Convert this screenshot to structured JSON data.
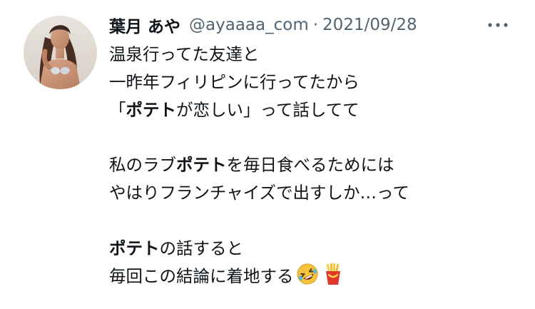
{
  "tweet": {
    "display_name": "葉月 あや",
    "handle": "@ayaaaa_com",
    "separator": "·",
    "date": "2021/09/28",
    "lines": [
      [
        {
          "t": "温泉行ってた友達と"
        }
      ],
      [
        {
          "t": "一昨年フィリピンに行ってたから"
        }
      ],
      [
        {
          "t": "「"
        },
        {
          "t": "ポテト",
          "bold": true
        },
        {
          "t": "が恋しい」って話してて"
        }
      ],
      [],
      [
        {
          "t": "私のラブ"
        },
        {
          "t": "ポテト",
          "bold": true
        },
        {
          "t": "を毎日食べるためには"
        }
      ],
      [
        {
          "t": "やはりフランチャイズで出すしか…って"
        }
      ],
      [],
      [
        {
          "t": "ポテト",
          "bold": true
        },
        {
          "t": "の話すると"
        }
      ],
      [
        {
          "t": "毎回この結論に着地する"
        }
      ]
    ],
    "trailing_emojis": [
      "rolling-on-floor-laughing-emoji",
      "french-fries-emoji"
    ]
  },
  "colors": {
    "primary_text": "#0f1419",
    "secondary_text": "#536471",
    "background": "#ffffff"
  },
  "icons": {
    "more": "more-options-icon"
  }
}
